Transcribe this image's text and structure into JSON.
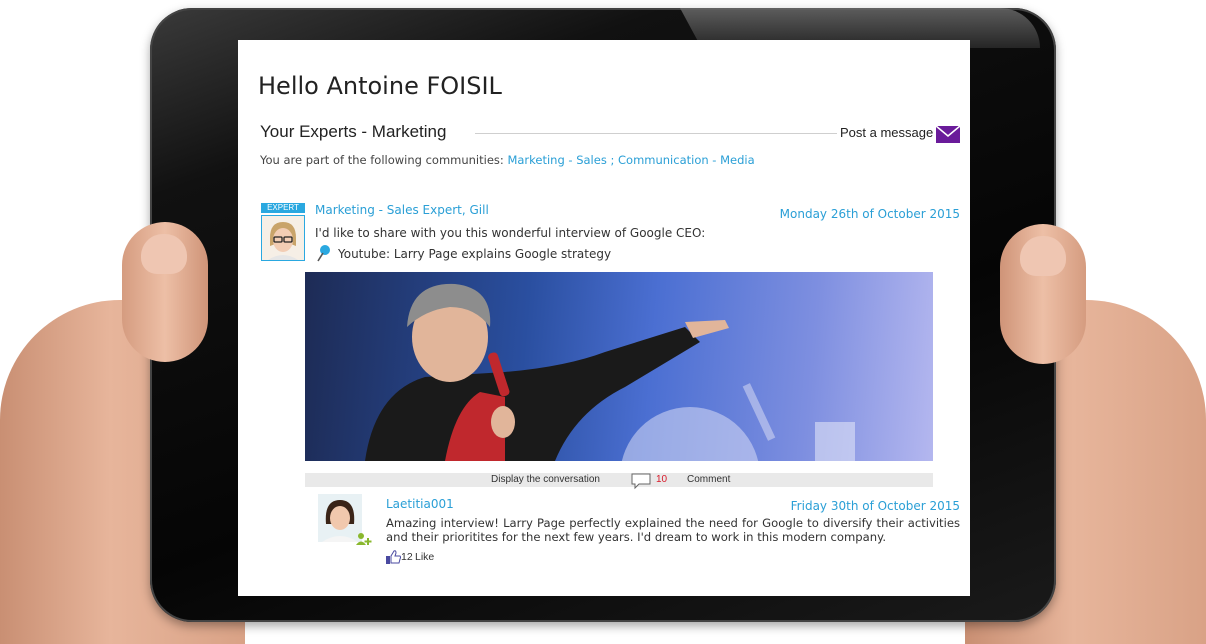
{
  "header": {
    "greeting": "Hello Antoine FOISIL"
  },
  "experts": {
    "title": "Your Experts - Marketing",
    "post_message_label": "Post a message",
    "communities_prefix": "You are part of the following communities:",
    "communities_links": "Marketing - Sales ; Communication - Media"
  },
  "post": {
    "badge": "EXPERT",
    "author": "Marketing - Sales Expert, Gill",
    "date": "Monday 26th of October 2015",
    "message": "I'd like to share with you this wonderful interview of Google CEO:",
    "link_label": "Youtube: Larry Page explains Google strategy",
    "display_conversation_label": "Display the conversation",
    "comment_count": "10",
    "comment_label": "Comment"
  },
  "reply": {
    "author": "Laetitia001",
    "date": "Friday 30th of October 2015",
    "message": "Amazing interview! Larry Page perfectly explained the need for Google to diversify their activities and their prioritites for the next few years. I'd dream to work in this modern company.",
    "like_count": "12",
    "like_label": "Like"
  },
  "colors": {
    "link_blue": "#2a9fd6",
    "accent_purple": "#6a1b9a",
    "comment_count_red": "#d81b2a"
  },
  "icons": [
    "mail-icon",
    "pin-icon",
    "comment-icon",
    "like-icon",
    "add-user-icon"
  ]
}
